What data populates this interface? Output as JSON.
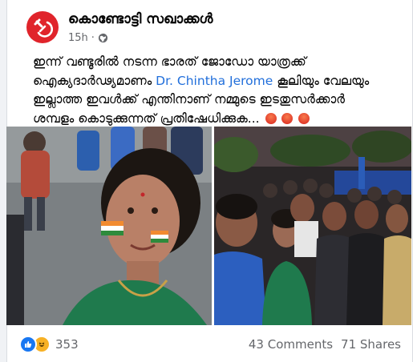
{
  "post": {
    "page_name": "കൊണ്ടോട്ടി സഖാക്കൾ",
    "time": "15h",
    "privacy_icon": "globe-icon",
    "avatar_icon": "hammer-sickle-icon",
    "text_lines": [
      "ഇന്ന് വണ്ടൂരിൽ നടന്ന ഭാരത് ജോഡോ യാത്രക്ക്",
      "ഐക്യദാർഢ്യമാണം",
      "Dr. Chintha Jerome",
      "കൂലിയും വേലയും",
      "ഇല്ലാത്ത ഇവൾക്ക് എന്തിനാണ് നമ്മുടെ ഇടതുസർക്കാർ",
      "ശമ്പളം കൊടുക്കുന്നത് പ്രതിഷേധിക്കുക...",
      "😡😡😡"
    ]
  },
  "photos": [
    {
      "name": "selfie-photo"
    },
    {
      "name": "group-photo"
    }
  ],
  "stats": {
    "reaction_count": "353",
    "comments": "43 Comments",
    "shares": "71 Shares"
  },
  "colors": {
    "brand_red": "#e0242b",
    "link": "#216fdb",
    "like": "#1877f2",
    "haha": "#f7b125"
  }
}
